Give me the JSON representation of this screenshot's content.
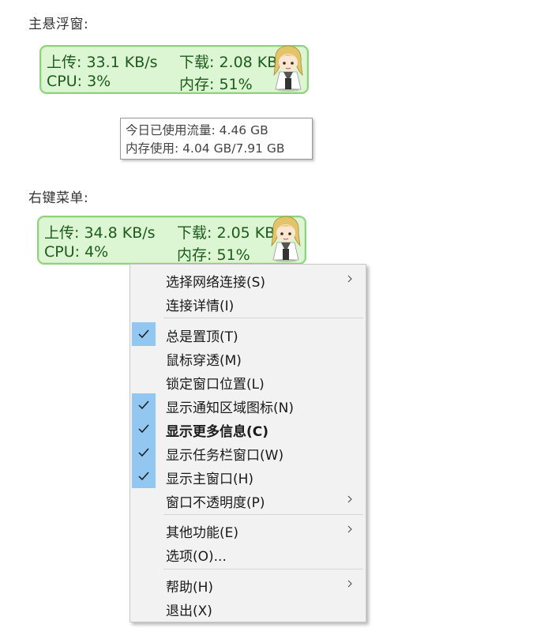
{
  "sections": {
    "float_heading": "主悬浮窗:",
    "menu_heading": "右键菜单:"
  },
  "float1": {
    "upload": "上传: 33.1 KB/s",
    "download": "下载: 2.08 KB/s",
    "cpu": "CPU: 3%",
    "memory": "内存: 51%"
  },
  "tooltip": {
    "traffic": "今日已使用流量: 4.46 GB",
    "memory_usage": "内存使用: 4.04 GB/7.91 GB"
  },
  "float2": {
    "upload": "上传: 34.8 KB/s",
    "download": "下载: 2.05 KB/s",
    "cpu": "CPU: 4%",
    "memory": "内存: 51%"
  },
  "menu": {
    "items": [
      {
        "label": "选择网络连接(S)",
        "checked": false,
        "submenu": true
      },
      {
        "label": "连接详情(I)",
        "checked": false,
        "submenu": false
      },
      {
        "label": "总是置顶(T)",
        "checked": true,
        "submenu": false
      },
      {
        "label": "鼠标穿透(M)",
        "checked": false,
        "submenu": false
      },
      {
        "label": "锁定窗口位置(L)",
        "checked": false,
        "submenu": false
      },
      {
        "label": "显示通知区域图标(N)",
        "checked": true,
        "submenu": false
      },
      {
        "label": "显示更多信息(C)",
        "checked": true,
        "submenu": false,
        "bold": true
      },
      {
        "label": "显示任务栏窗口(W)",
        "checked": true,
        "submenu": false
      },
      {
        "label": "显示主窗口(H)",
        "checked": true,
        "submenu": false
      },
      {
        "label": "窗口不透明度(P)",
        "checked": false,
        "submenu": true
      },
      {
        "label": "其他功能(E)",
        "checked": false,
        "submenu": true
      },
      {
        "label": "选项(O)...",
        "checked": false,
        "submenu": false
      },
      {
        "label": "帮助(H)",
        "checked": false,
        "submenu": true
      },
      {
        "label": "退出(X)",
        "checked": false,
        "submenu": false
      }
    ]
  },
  "colors": {
    "float_bg": "#dcf5d3",
    "float_border": "#8fd27c",
    "float_text": "#1d5b1d",
    "check_highlight": "#92c7f2",
    "menu_bg": "#f2f2f2"
  },
  "icons": {
    "mascot": "anime-girl-mascot-icon",
    "check": "checkmark-icon",
    "submenu": "chevron-right-icon"
  }
}
